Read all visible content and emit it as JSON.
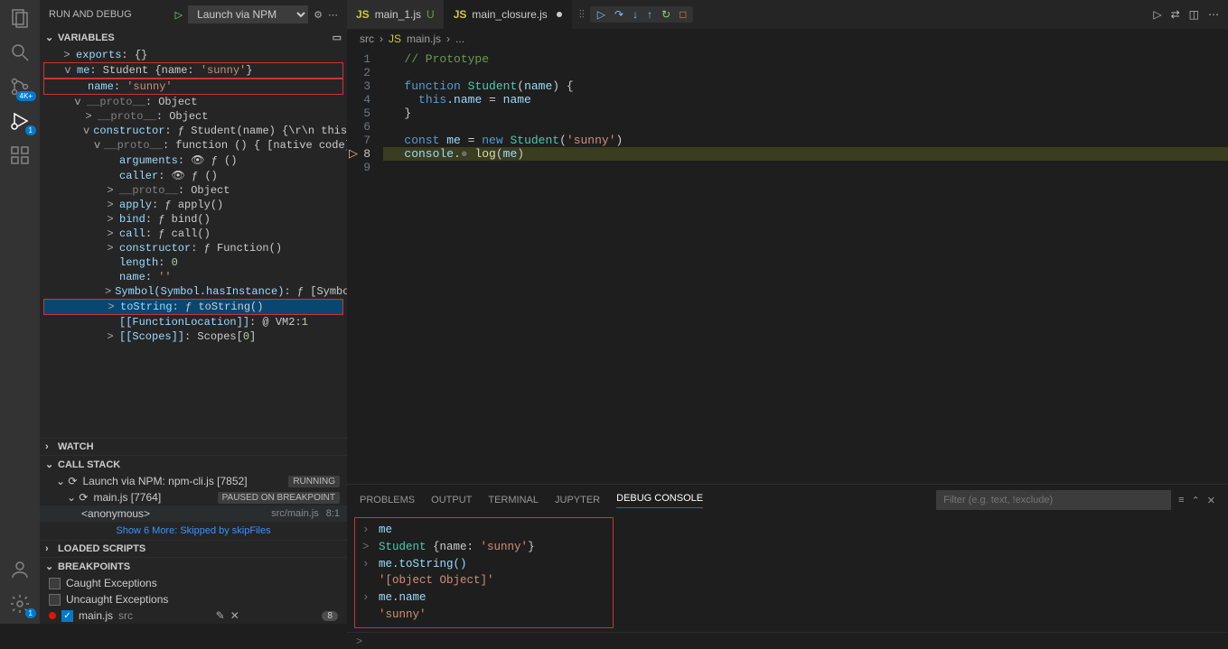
{
  "activitybar": {
    "badges": {
      "scm": "4K+",
      "debug": "1",
      "settings": "1"
    }
  },
  "sidebar": {
    "title": "RUN AND DEBUG",
    "launch_config": "Launch via NPM",
    "sections": {
      "variables": "VARIABLES",
      "watch": "WATCH",
      "callstack": "CALL STACK",
      "loaded": "LOADED SCRIPTS",
      "breakpoints": "BREAKPOINTS"
    },
    "var_tree": [
      {
        "ind": 1,
        "tw": ">",
        "text": "exports: {}"
      },
      {
        "ind": 1,
        "tw": "v",
        "text": "me: Student {name: 'sunny'}",
        "red": true
      },
      {
        "ind": 2,
        "tw": "",
        "text": "name: 'sunny'",
        "red": true
      },
      {
        "ind": 2,
        "tw": "v",
        "text": "__proto__: Object"
      },
      {
        "ind": 3,
        "tw": ">",
        "text": "__proto__: Object"
      },
      {
        "ind": 3,
        "tw": "v",
        "text": "constructor: ƒ Student(name) {\\r\\n  this.name…"
      },
      {
        "ind": 4,
        "tw": "v",
        "text": "__proto__: function () { [native code] }"
      },
      {
        "ind": 5,
        "tw": "",
        "text": "arguments: 👁 ƒ ()"
      },
      {
        "ind": 5,
        "tw": "",
        "text": "caller: 👁 ƒ ()"
      },
      {
        "ind": 5,
        "tw": ">",
        "text": "__proto__: Object"
      },
      {
        "ind": 5,
        "tw": ">",
        "text": "apply: ƒ apply()"
      },
      {
        "ind": 5,
        "tw": ">",
        "text": "bind: ƒ bind()"
      },
      {
        "ind": 5,
        "tw": ">",
        "text": "call: ƒ call()"
      },
      {
        "ind": 5,
        "tw": ">",
        "text": "constructor: ƒ Function()"
      },
      {
        "ind": 5,
        "tw": "",
        "text": "length: 0"
      },
      {
        "ind": 5,
        "tw": "",
        "text": "name: ''"
      },
      {
        "ind": 5,
        "tw": ">",
        "text": "Symbol(Symbol.hasInstance): ƒ [Symbol.hasI…"
      },
      {
        "ind": 5,
        "tw": ">",
        "text": "toString: ƒ toString()",
        "blue": true,
        "red": true
      },
      {
        "ind": 5,
        "tw": "",
        "text": "[[FunctionLocation]]: @ VM2:1"
      },
      {
        "ind": 5,
        "tw": ">",
        "text": "[[Scopes]]: Scopes[0]"
      }
    ],
    "callstack": {
      "root": "Launch via NPM: npm-cli.js [7852]",
      "root_badge": "RUNNING",
      "thread": "main.js [7764]",
      "thread_badge": "PAUSED ON BREAKPOINT",
      "frame": "<anonymous>",
      "frame_loc": "src/main.js",
      "frame_pos": "8:1",
      "more": "Show 6 More: Skipped by skipFiles"
    },
    "breakpoints": {
      "caught": "Caught Exceptions",
      "uncaught": "Uncaught Exceptions",
      "bp_file": "main.js",
      "bp_dir": "src",
      "bp_count": "8"
    }
  },
  "tabs": {
    "t1": "main_1.js",
    "t1_mark": "U",
    "t2": "main_closure.js"
  },
  "breadcrumbs": {
    "seg1": "src",
    "seg2": "main.js",
    "seg3": "..."
  },
  "code": {
    "l1": "// Prototype",
    "l3_kw": "function",
    "l3_cls": "Student",
    "l3_prm": "name",
    "l4_this": "this",
    "l4_prop": ".name",
    "l4_op": " = ",
    "l4_var": "name",
    "l7_kw": "const",
    "l7_var": "me",
    "l7_new": "new",
    "l7_cls": "Student",
    "l7_str": "'sunny'",
    "l8_obj": "console",
    "l8_fn": "log",
    "l8_arg": "me"
  },
  "panel": {
    "tabs": {
      "problems": "PROBLEMS",
      "output": "OUTPUT",
      "terminal": "TERMINAL",
      "jupyter": "JUPYTER",
      "debug": "DEBUG CONSOLE"
    },
    "filter_placeholder": "Filter (e.g. text, !exclude)",
    "console": {
      "r1": "me",
      "r2a": "Student",
      "r2b": "{name: ",
      "r2c": "'sunny'",
      "r2d": "}",
      "r3": "me.toString()",
      "r4": "'[object Object]'",
      "r5": "me.name",
      "r6": "'sunny'"
    }
  }
}
